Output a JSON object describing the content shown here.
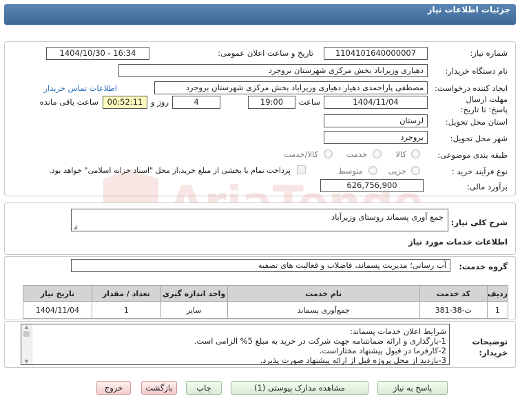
{
  "header": {
    "title": "جزئیات اطلاعات نیاز"
  },
  "form": {
    "need_number_label": "شماره نیاز:",
    "need_number": "1104101640000007",
    "announce_label": "تاریخ و ساعت اعلان عمومی:",
    "announce_value": "1404/10/30 - 16:34",
    "buyer_org_label": "نام دستگاه خریدار:",
    "buyer_org": "دهیاری وزیراباد بخش مرکزی شهرستان بروجرد",
    "requester_label": "ایجاد کننده درخواست:",
    "requester": "مصطفی پاراحمدی دهیار دهیاری وزیراباد بخش مرکزی شهرستان بروجرد",
    "contact_link": "اطلاعات تماس خریدار",
    "deadline_label": "مهلت ارسال پاسخ: تا تاریخ:",
    "deadline_date": "1404/11/04",
    "time_label": "ساعت",
    "deadline_time": "19:00",
    "days_value": "4",
    "days_label": "روز و",
    "remaining_time": "00:52:11",
    "remaining_label": "ساعت باقی مانده",
    "province_label": "استان محل تحویل:",
    "province": "لرستان",
    "city_label": "شهر محل تحویل:",
    "city": "بروجرد",
    "category_label": "طبقه بندی موضوعی:",
    "category_options": [
      "کالا",
      "خدمت",
      "کالا/خدمت"
    ],
    "process_label": "نوع فرآیند خرید :",
    "process_options": [
      "جزیی",
      "متوسط"
    ],
    "payment_note": "پرداخت تمام یا بخشی از مبلغ خرید،از محل \"اسناد خزانه اسلامی\" خواهد بود.",
    "budget_label": "برآورد مالی:",
    "budget": "626,756,900"
  },
  "summary": {
    "label": "شرح کلی نیاز:",
    "value": "جمع آوری پسماند روستای وزیرآباد"
  },
  "services": {
    "section_title": "اطلاعات خدمات مورد نیاز",
    "group_label": "گروه خدمت:",
    "group_value": "آب رسانی؛ مدیریت پسماند، فاضلاب و فعالیت های تصفیه",
    "columns": [
      "ردیف",
      "کد خدمت",
      "نام خدمت",
      "واحد اندازه گیری",
      "تعداد / مقدار",
      "تاریخ نیاز"
    ],
    "rows": [
      {
        "row": "1",
        "code": "ث-38-381",
        "name": "جمع‌آوری پسماند",
        "unit": "سایر",
        "qty": "1",
        "date": "1404/11/04"
      }
    ]
  },
  "notes": {
    "label": "توضیحات خریدار:",
    "lines": [
      "شرایط اعلان خدمات پسماند:",
      "1-بارگذاری و ارائه ضمانتنامه جهت شرکت در خرید به مبلغ 5% الزامی است.",
      "2-کارفرما در قبول پیشنهاد مختاراست.",
      "3-بازدید از محل پروژه قبل از ارائه پیشنهاد صورت پذیرد."
    ]
  },
  "buttons": {
    "reply": "پاسخ به نیاز",
    "view_docs": "مشاهده مدارک پیوستی (1)",
    "print": "چاپ",
    "back": "بازگشت",
    "exit": "خروج"
  },
  "watermark_text": "AriaTender.neT"
}
